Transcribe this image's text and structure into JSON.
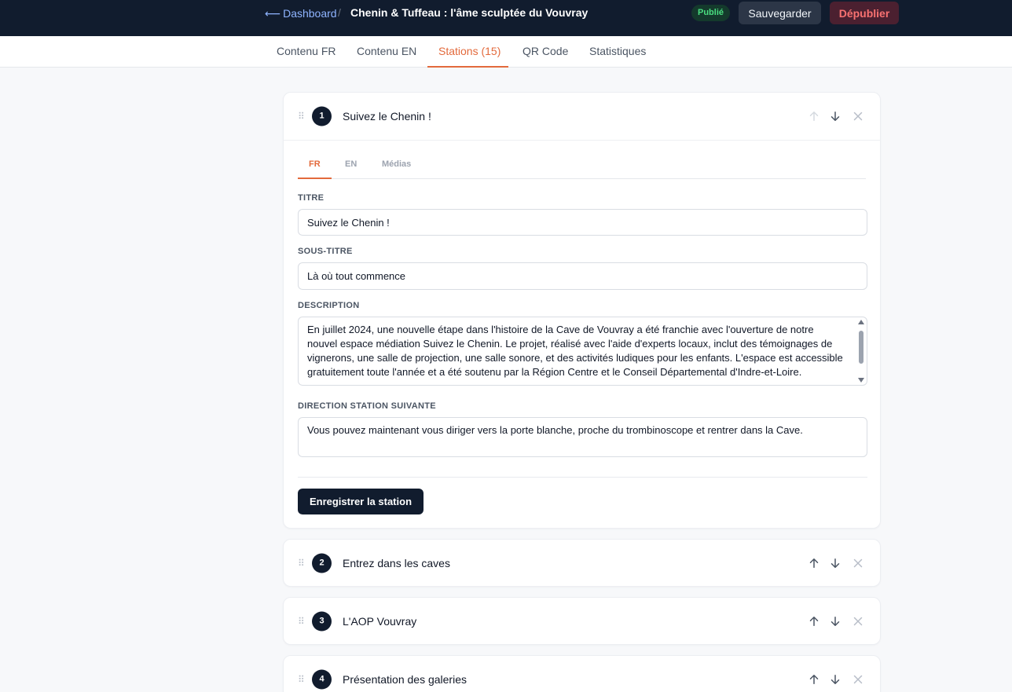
{
  "header": {
    "back_label": "Dashboard",
    "separator": "/",
    "title": "Chenin & Tuffeau : l'âme sculptée du Vouvray",
    "status_badge": "Publié",
    "save_label": "Sauvegarder",
    "unpublish_label": "Dépublier"
  },
  "tabs": [
    {
      "label": "Contenu FR"
    },
    {
      "label": "Contenu EN"
    },
    {
      "label": "Stations (15)"
    },
    {
      "label": "QR Code"
    },
    {
      "label": "Statistiques"
    }
  ],
  "active_tab": "Stations (15)",
  "drag_glyph": "⠿",
  "stations": [
    {
      "number": "1",
      "title": "Suivez le Chenin !"
    },
    {
      "number": "2",
      "title": "Entrez dans les caves"
    },
    {
      "number": "3",
      "title": "L'AOP Vouvray"
    },
    {
      "number": "4",
      "title": "Présentation des galeries"
    }
  ],
  "editor": {
    "subtabs": [
      {
        "label": "FR"
      },
      {
        "label": "EN"
      },
      {
        "label": "Médias"
      }
    ],
    "active_subtab": "FR",
    "title_label": "TITRE",
    "title_value": "Suivez le Chenin !",
    "subtitle_label": "SOUS-TITRE",
    "subtitle_value": "Là où tout commence",
    "description_label": "DESCRIPTION",
    "description_value": "En juillet 2024, une nouvelle étape dans l'histoire de la Cave de Vouvray a été franchie avec l'ouverture de notre nouvel espace médiation Suivez le Chenin. Le projet, réalisé avec l'aide d'experts locaux, inclut des témoignages de vignerons, une salle de projection, une salle sonore, et des activités ludiques pour les enfants. L'espace est accessible gratuitement toute l'année et a été soutenu par la Région Centre et le Conseil Départemental d'Indre-et-Loire.",
    "direction_label": "DIRECTION STATION SUIVANTE",
    "direction_value": "Vous pouvez maintenant vous diriger vers la porte blanche, proche du trombinoscope et rentrer dans la Cave.",
    "submit_label": "Enregistrer la station"
  },
  "colors": {
    "header_bg": "#111c2e",
    "accent": "#e36a3c",
    "badge_text": "#4ade80",
    "unpublish_text": "#f87171"
  },
  "icons": [
    "arrow-left-icon",
    "drag-handle-icon",
    "arrow-up-icon",
    "arrow-down-icon",
    "close-icon"
  ]
}
